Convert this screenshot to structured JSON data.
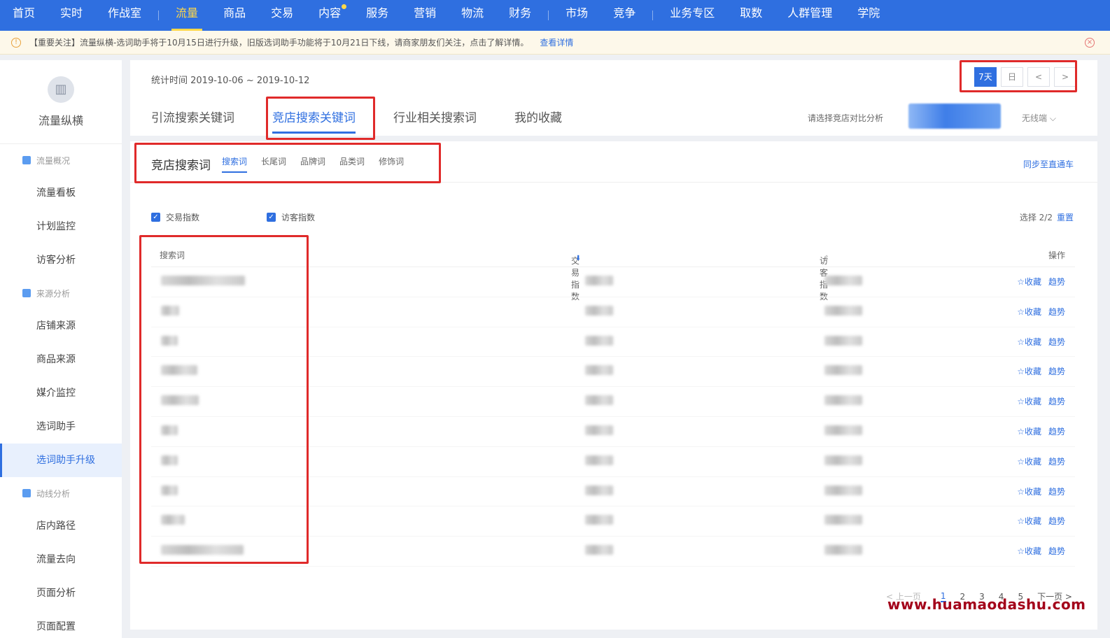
{
  "topnav": {
    "items": [
      "首页",
      "实时",
      "作战室",
      "流量",
      "商品",
      "交易",
      "内容",
      "服务",
      "营销",
      "物流",
      "财务",
      "市场",
      "竞争",
      "业务专区",
      "取数",
      "人群管理",
      "学院"
    ],
    "active": "流量"
  },
  "notice": {
    "text": "【重要关注】流量纵横-选词助手将于10月15日进行升级，旧版选词助手功能将于10月21日下线，请商家朋友们关注，点击了解详情。",
    "link": "查看详情"
  },
  "sidebar": {
    "logo_name": "流量纵横",
    "groups": [
      {
        "label": "流量概况",
        "items": [
          "流量看板",
          "计划监控",
          "访客分析"
        ]
      },
      {
        "label": "来源分析",
        "items": [
          "店铺来源",
          "商品来源",
          "媒介监控",
          "选词助手",
          "选词助手升级"
        ]
      },
      {
        "label": "动线分析",
        "items": [
          "店内路径",
          "流量去向",
          "页面分析",
          "页面配置"
        ]
      }
    ],
    "active_item": "选词助手升级"
  },
  "header": {
    "stat_time": "统计时间 2019-10-06 ~ 2019-10-12",
    "date_buttons": {
      "week": "7天",
      "calendar": "日",
      "prev": "<",
      "next": ">"
    },
    "tabs": [
      "引流搜索关键词",
      "竞店搜索关键词",
      "行业相关搜索词",
      "我的收藏"
    ],
    "active_tab": "竞店搜索关键词",
    "compare_label": "请选择竞店对比分析",
    "nofilter_label": "无线端"
  },
  "sub": {
    "title": "竞店搜索词",
    "tabs": [
      "搜索词",
      "长尾词",
      "品牌词",
      "品类词",
      "修饰词"
    ],
    "active_tab": "搜索词",
    "sync_label": "同步至直通车"
  },
  "metrics": {
    "checks": [
      "交易指数",
      "访客指数"
    ],
    "selected": "选择 2/2",
    "reset": "重置"
  },
  "table": {
    "headers": {
      "keyword": "搜索词",
      "trade": "交易指数",
      "visitor": "访客指数",
      "op": "操作"
    },
    "ops": {
      "collect": "☆收藏",
      "trend": "趋势"
    },
    "row_count": 10
  },
  "pager": {
    "prev": "< 上一页",
    "pages": [
      "1",
      "2",
      "3",
      "4",
      "5"
    ],
    "next": "下一页 >",
    "current": "1"
  },
  "watermark": "www.huamaodashu.com",
  "colors": {
    "primary": "#2f6fe0",
    "highlight": "#ffd84a",
    "annotation": "#e02a2a"
  }
}
